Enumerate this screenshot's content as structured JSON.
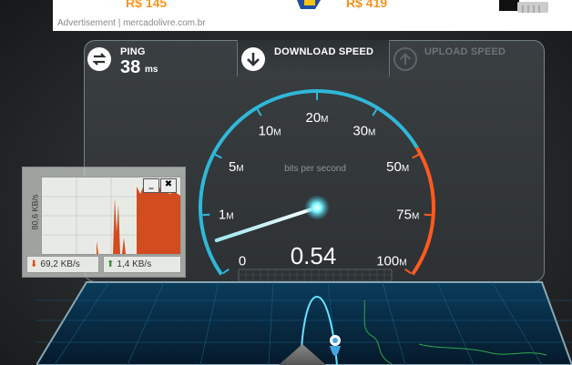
{
  "ad": {
    "prices": [
      "R$ 145",
      "R$ 419"
    ],
    "label": "Advertisement",
    "sep": " | ",
    "source": "mercadolivre.com.br"
  },
  "tabs": {
    "ping": {
      "label": "PING",
      "value": "38",
      "unit": "ms"
    },
    "download": {
      "label": "DOWNLOAD SPEED"
    },
    "upload": {
      "label": "UPLOAD SPEED"
    }
  },
  "gauge": {
    "caption": "bits per second",
    "reading": "0.54",
    "ticks": [
      {
        "num": "0",
        "unit": ""
      },
      {
        "num": "1",
        "unit": "M"
      },
      {
        "num": "5",
        "unit": "M"
      },
      {
        "num": "10",
        "unit": "M"
      },
      {
        "num": "20",
        "unit": "M"
      },
      {
        "num": "30",
        "unit": "M"
      },
      {
        "num": "50",
        "unit": "M"
      },
      {
        "num": "75",
        "unit": "M"
      },
      {
        "num": "100",
        "unit": "M"
      }
    ],
    "needle_value_mbps": 0.54,
    "colors": {
      "arc": "#2fb8d8",
      "hot": "#ff5a1f",
      "glow": "#7ff6ff"
    }
  },
  "mini_monitor": {
    "y_label": "80,6 KB/s",
    "download": "69,2 KB/s",
    "upload": "1,4 KB/s",
    "minimize": "_",
    "close": "✖",
    "colors": {
      "download": "#d24c1f",
      "upload": "#3a8a3a"
    }
  }
}
